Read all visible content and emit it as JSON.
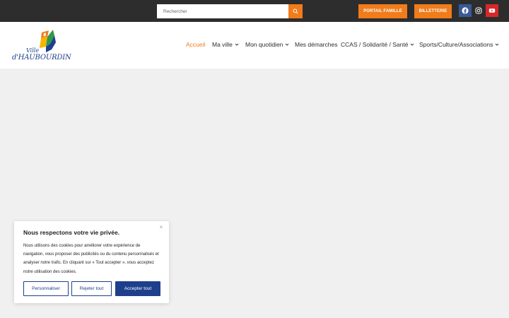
{
  "search": {
    "placeholder": "Rechercher"
  },
  "top_buttons": {
    "portail": "PORTAIL FAMILLE",
    "billetterie": "BILLETTERIE"
  },
  "social": {
    "facebook": "facebook-icon",
    "instagram": "instagram-icon",
    "youtube": "youtube-icon"
  },
  "logo": {
    "line1": "Ville",
    "line2": "d'HAUBOURDIN"
  },
  "nav": [
    {
      "label": "Accueil"
    },
    {
      "label": "Ma ville"
    },
    {
      "label": "Mon quotidien"
    },
    {
      "label": "Mes démarches"
    },
    {
      "label": "CCAS / Solidarité / Santé"
    },
    {
      "label": "Sports/Culture/Associations"
    }
  ],
  "cookie": {
    "title": "Nous respectons votre vie privée.",
    "body": "Nous utilisons des cookies pour améliorer votre expérience de navigation, vous proposer des publicités ou du contenu personnalisés et analyser notre trafic. En cliquant sur « Tout accepter », vous acceptez notre utilisation des cookies.",
    "customize": "Personnaliser",
    "reject": "Rejeter tout",
    "accept": "Accepter tout",
    "close": "×"
  },
  "colors": {
    "accent": "#f07c1b",
    "brand": "#1d3f8c",
    "topbar": "#2d2d2d"
  }
}
